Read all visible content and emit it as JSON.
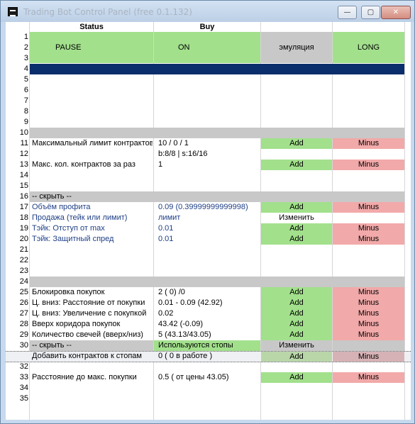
{
  "window": {
    "title": "Trading Bot Control Panel (free 0.1.132)",
    "minimize_glyph": "—",
    "maximize_glyph": "▢",
    "close_glyph": "✕"
  },
  "headers": {
    "status": "Status",
    "buy": "Buy"
  },
  "row_numbers": [
    "1",
    "2",
    "3",
    "4",
    "5",
    "6",
    "7",
    "8",
    "9",
    "10",
    "11",
    "12",
    "13",
    "14",
    "15",
    "16",
    "17",
    "18",
    "19",
    "20",
    "21",
    "22",
    "23",
    "24",
    "25",
    "26",
    "27",
    "28",
    "29",
    "30",
    "31",
    "32",
    "33",
    "34",
    "35"
  ],
  "top": {
    "status": "PAUSE",
    "buy": "ON",
    "mode": "эмуляция",
    "direction": "LONG"
  },
  "rows": {
    "r11": {
      "label": "Максимальный лимит контрактов",
      "value": "10 / 0 / 1",
      "add": "Add",
      "minus": "Minus"
    },
    "r12": {
      "value": "b:8/8 | s:16/16"
    },
    "r13": {
      "label": "Макс. кол. контрактов за раз",
      "value": "1",
      "add": "Add",
      "minus": "Minus"
    },
    "r16": {
      "label": "-- скрыть --"
    },
    "r17": {
      "label": "Объём профита",
      "value": "0.09 (0.39999999999998)",
      "add": "Add",
      "minus": "Minus"
    },
    "r18": {
      "label": "Продажа (тейк или лимит)",
      "value": "лимит",
      "change": "Изменить"
    },
    "r19": {
      "label": "Тэйк: Отступ от max",
      "value": "0.01",
      "add": "Add",
      "minus": "Minus"
    },
    "r20": {
      "label": "Тэйк: Защитный спред",
      "value": "0.01",
      "add": "Add",
      "minus": "Minus"
    },
    "r25": {
      "label": "Блокировка покупок",
      "value": "2 ( 0) /0",
      "add": "Add",
      "minus": "Minus"
    },
    "r26": {
      "label": "Ц. вниз: Расстояние от покупки",
      "value": "0.01 - 0.09 (42.92)",
      "add": "Add",
      "minus": "Minus"
    },
    "r27": {
      "label": "Ц. вниз: Увеличение с покупкой",
      "value": "0.02",
      "add": "Add",
      "minus": "Minus"
    },
    "r28": {
      "label": "Вверх коридора покупок",
      "value": "43.42 (-0.09)",
      "add": "Add",
      "minus": "Minus"
    },
    "r29": {
      "label": "Количество свечей (вверх/низ)",
      "value": "5 (43.13/43.05)",
      "add": "Add",
      "minus": "Minus"
    },
    "r30": {
      "label": "-- скрыть --",
      "value": "Используются стопы",
      "change": "Изменить"
    },
    "r31": {
      "label": "Добавить контрактов к стопам",
      "value": "0 ( 0 в работе )",
      "add": "Add",
      "minus": "Minus"
    },
    "r33": {
      "label": "Расстояние до макс. покупки",
      "value": "0.5 ( от цены 43.05)",
      "add": "Add",
      "minus": "Minus"
    }
  },
  "colors": {
    "green": "#a2e08c",
    "red": "#f2a9a9",
    "gray": "#c8c8c8",
    "navy": "#0a2d6b",
    "label_blue": "#1f3f86"
  }
}
